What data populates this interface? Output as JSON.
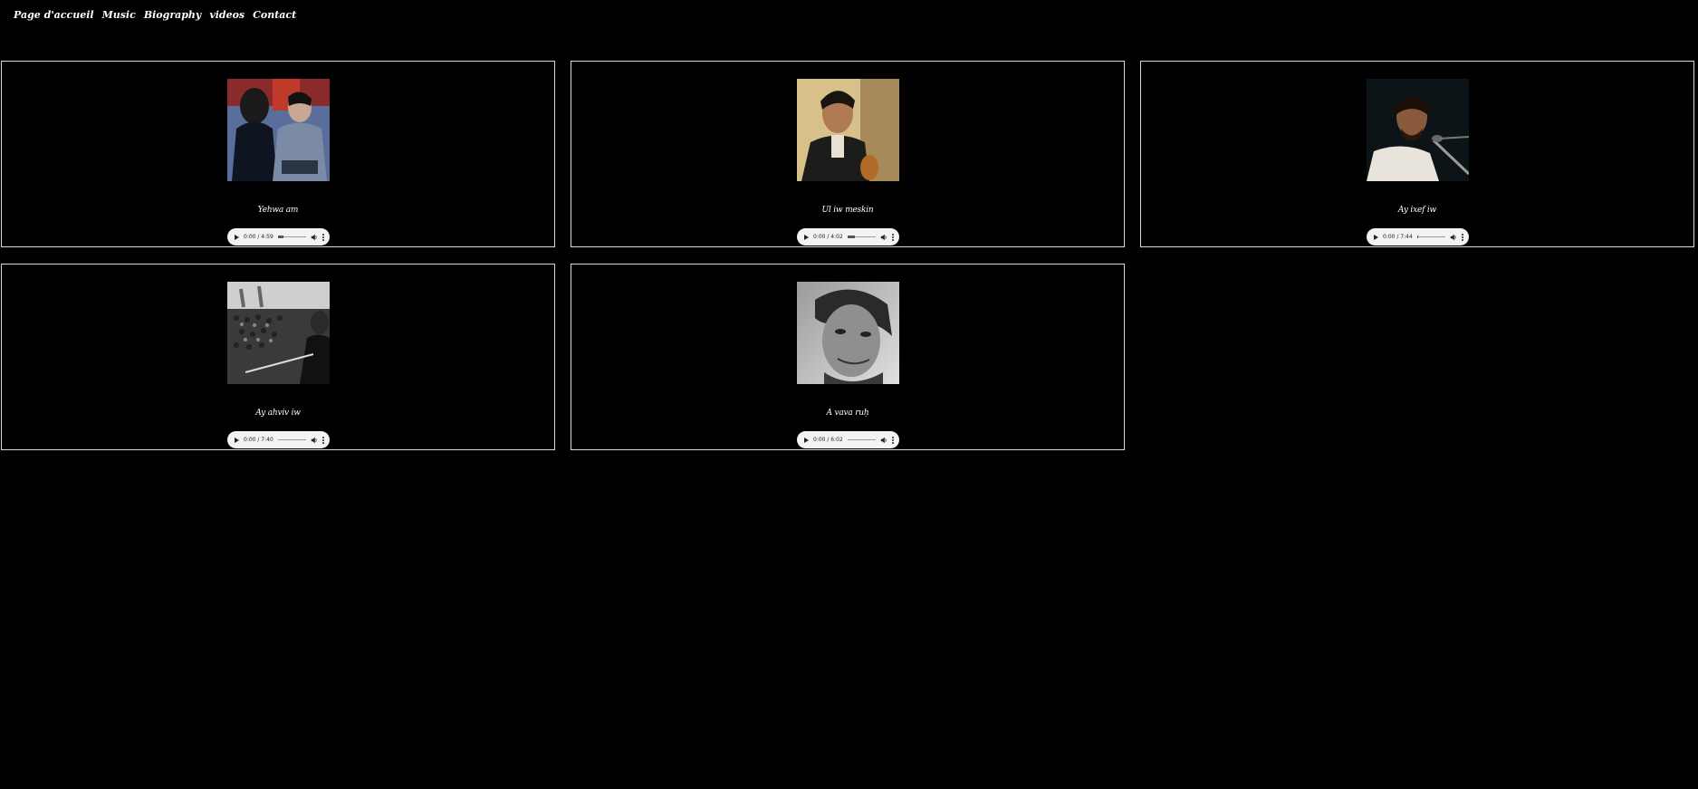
{
  "nav": {
    "home": "Page d'accueil",
    "music": "Music",
    "biography": "Biography",
    "videos": "videos",
    "contact": "Contact"
  },
  "tracks": [
    {
      "title": "Yehwa am",
      "time": "0:00 / 4:59",
      "progress": 0.2,
      "image": "two people in coats, color photo"
    },
    {
      "title": "Ul iw meskin",
      "time": "0:00 / 4:02",
      "progress": 0.25,
      "image": "man with guitar, warm tones"
    },
    {
      "title": "Ay ixef iw",
      "time": "0:00 / 7:44",
      "progress": 0.05,
      "image": "man singing at microphone"
    },
    {
      "title": "Ay ahviv iw",
      "time": "0:00 / 7:40",
      "progress": 0.0,
      "image": "crowd black and white"
    },
    {
      "title": "A vava ruḥ",
      "time": "0:00 / 6:02",
      "progress": 0.0,
      "image": "black and white portrait"
    }
  ]
}
